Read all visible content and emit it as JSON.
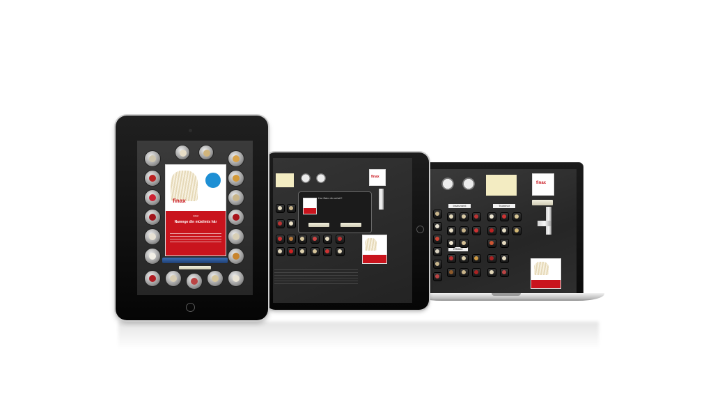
{
  "brand": {
    "logo": "finax",
    "accent": "#c9141d",
    "badge_color": "#1e8fd4"
  },
  "devices": [
    {
      "kind": "laptop"
    },
    {
      "kind": "tablet-landscape"
    },
    {
      "kind": "tablet-portrait"
    }
  ],
  "portrait_tablet": {
    "pack_headline": "Namnge din müslimix här",
    "pack_subline": "mixat"
  },
  "landscape_tablet": {
    "dialog_title": "Hur låter din müsli?"
  },
  "laptop": {
    "tab_left": "Instrument",
    "tab_right": "Trummor",
    "section": "Effekter"
  }
}
